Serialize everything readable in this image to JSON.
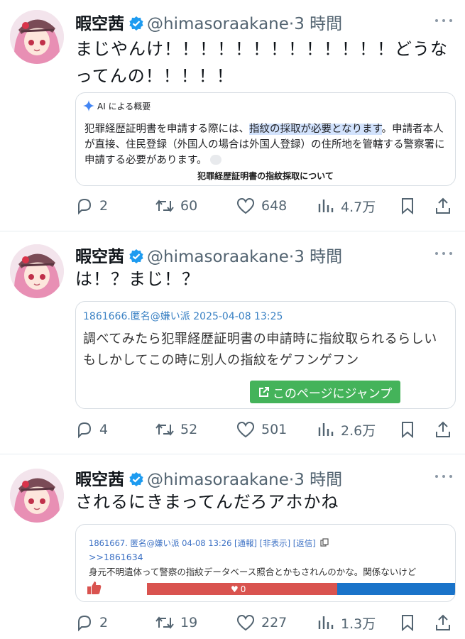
{
  "tweets": [
    {
      "name": "暇空茜",
      "handle": "@himasoraakane",
      "dot": "·",
      "time": "3 時間",
      "text": "まじやんけ！！！！！！！！！！！！！どうなってんの！！！！！",
      "card": {
        "header": "AI による概要",
        "pre": "犯罪経歴証明書を申請する際には、",
        "highlight": "指紋の採取が必要となります",
        "post": "。申請者本人が直接、住民登録（外国人の場合は外国人登録）の住所地を管轄する警察署に申請する必要があります。",
        "link": "犯罪経歴証明書の指紋採取について"
      },
      "stats": {
        "replies": "2",
        "retweets": "60",
        "likes": "648",
        "views": "4.7万"
      }
    },
    {
      "name": "暇空茜",
      "handle": "@himasoraakane",
      "dot": "·",
      "time": "3 時間",
      "text": "は！？まじ！？",
      "card": {
        "header": "1861666.匿名@嫌い派 2025-04-08 13:25",
        "line1": "調べてみたら犯罪経歴証明書の申請時に指紋取られるらしい",
        "line2": "もしかしてこの時に別人の指紋をゲフンゲフン",
        "button": "このページにジャンプ"
      },
      "stats": {
        "replies": "4",
        "retweets": "52",
        "likes": "501",
        "views": "2.6万"
      }
    },
    {
      "name": "暇空茜",
      "handle": "@himasoraakane",
      "dot": "·",
      "time": "3 時間",
      "text": "されるにきまってんだろアホかね",
      "card": {
        "header": "1861667. 匿名@嫌い派 04-08 13:26 [通報] [非表示] [返信]",
        "ref": ">>1861634",
        "text": "身元不明遺体って警察の指紋データベース照合とかもされんのかな。関係ないけど",
        "heart_count": "0"
      },
      "stats": {
        "replies": "2",
        "retweets": "19",
        "likes": "227",
        "views": "1.3万"
      }
    }
  ],
  "colors": {
    "accent": "#1d9bf0",
    "muted": "#536471",
    "jump_button": "#44b35a"
  }
}
